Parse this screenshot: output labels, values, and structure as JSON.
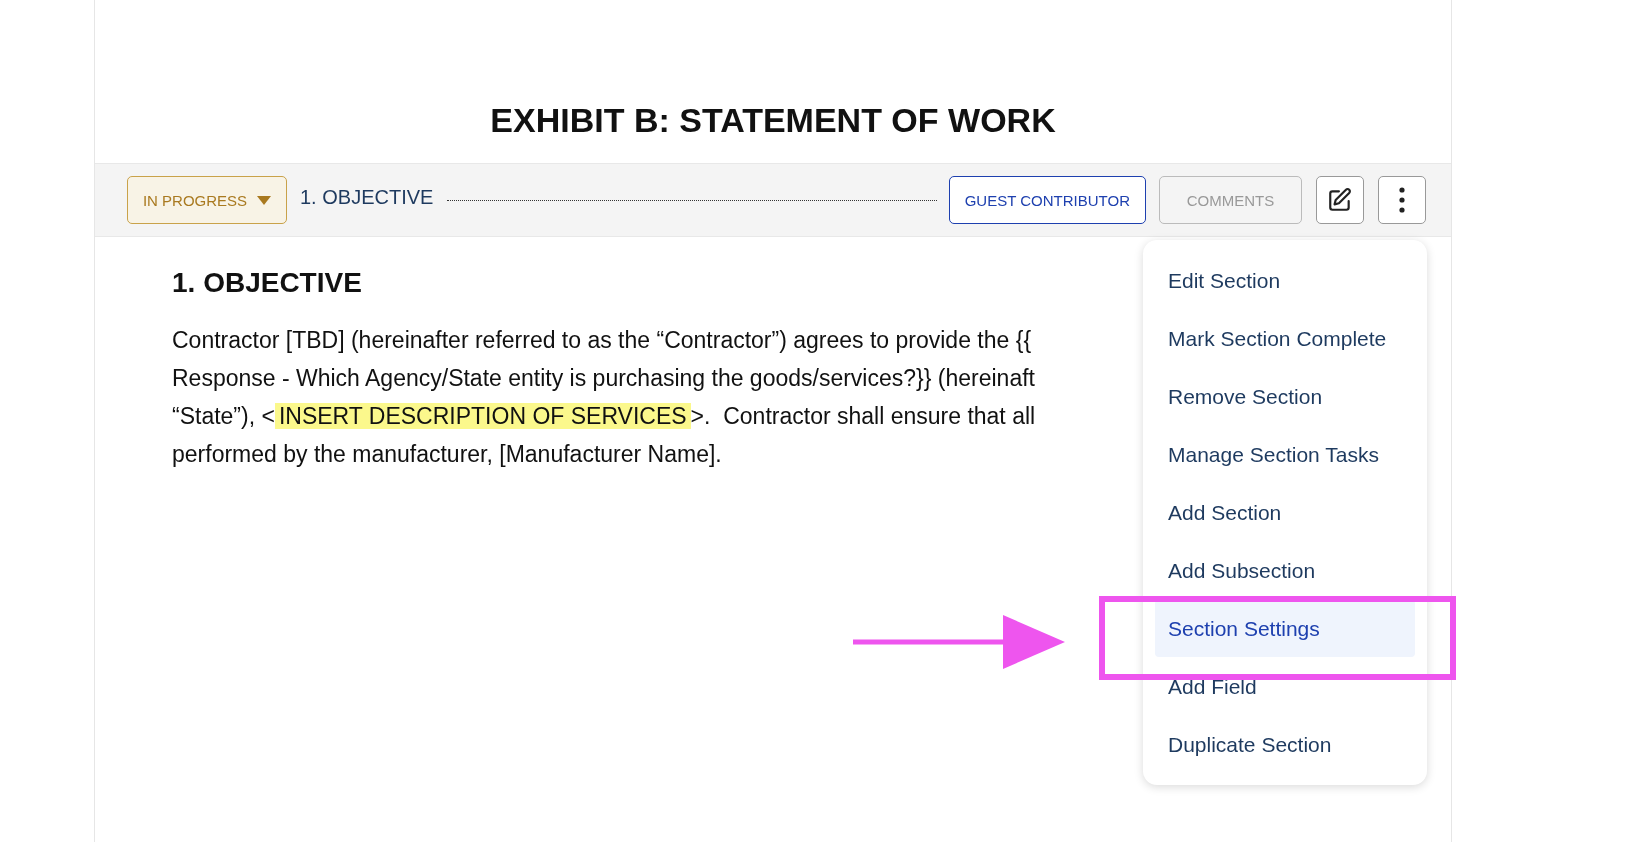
{
  "document": {
    "title": "EXHIBIT B: STATEMENT OF WORK"
  },
  "section_bar": {
    "status": {
      "label": "IN PROGRESS",
      "expanded": false
    },
    "section_label": "1. OBJECTIVE",
    "buttons": [
      {
        "label": "GUEST CONTRIBUTOR",
        "disabled": false
      },
      {
        "label": "COMMENTS",
        "disabled": true
      }
    ]
  },
  "section": {
    "heading": "1. OBJECTIVE",
    "lines": [
      {
        "text": "Contractor [TBD] (hereinafter referred to as the “Contractor”) agrees to provide the {{"
      },
      {
        "text": "Response - Which Agency/State entity is purchasing the goods/services?}} (hereinaft"
      },
      {
        "text": "“State”), <",
        "highlight": "INSERT DESCRIPTION OF SERVICES",
        "after": ">.  Contractor shall ensure that all"
      },
      {
        "text": "performed by the manufacturer, [Manufacturer Name]."
      }
    ]
  },
  "menu": {
    "items": [
      {
        "label": "Edit Section",
        "selected": false
      },
      {
        "label": "Mark Section Complete",
        "selected": false
      },
      {
        "label": "Remove Section",
        "selected": false
      },
      {
        "label": "Manage Section Tasks",
        "selected": false
      },
      {
        "label": "Add Section",
        "selected": false
      },
      {
        "label": "Add Subsection",
        "selected": false
      },
      {
        "label": "Section Settings",
        "selected": true
      },
      {
        "label": "Add Field",
        "selected": false
      },
      {
        "label": "Duplicate Section",
        "selected": false
      }
    ]
  }
}
